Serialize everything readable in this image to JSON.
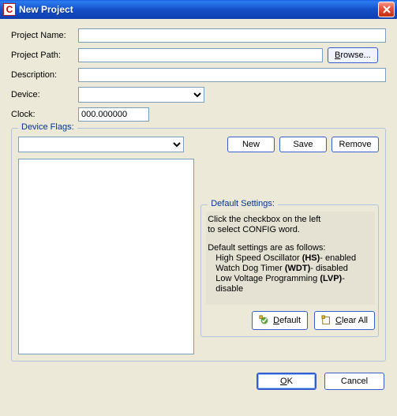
{
  "title": "New Project",
  "app_icon_letter": "C",
  "labels": {
    "project_name": "Project Name:",
    "project_path": "Project Path:",
    "description": "Description:",
    "device": "Device:",
    "clock": "Clock:"
  },
  "fields": {
    "project_name": "",
    "project_path": "",
    "description": "",
    "device": "",
    "clock": "000.000000"
  },
  "browse_label": "Browse...",
  "device_flags": {
    "group_title": "Device Flags:",
    "combo_value": "",
    "buttons": {
      "new": "New",
      "save": "Save",
      "remove": "Remove"
    },
    "default_settings": {
      "group_title": "Default Settings:",
      "line1": "Click the checkbox on the left",
      "line2": "to select CONFIG word.",
      "line3": "Default settings are as follows:",
      "item1_pre": "High Speed Oscillator ",
      "item1_bold": "(HS)",
      "item1_post": "- enabled",
      "item2_pre": "Watch Dog Timer ",
      "item2_bold": "(WDT)",
      "item2_post": "- disabled",
      "item3_pre": "Low Voltage Programming ",
      "item3_bold": "(LVP)",
      "item3_post": "- disable",
      "default_btn": "Default",
      "clear_btn": "Clear All"
    }
  },
  "dialog_buttons": {
    "ok": "OK",
    "cancel": "Cancel"
  }
}
